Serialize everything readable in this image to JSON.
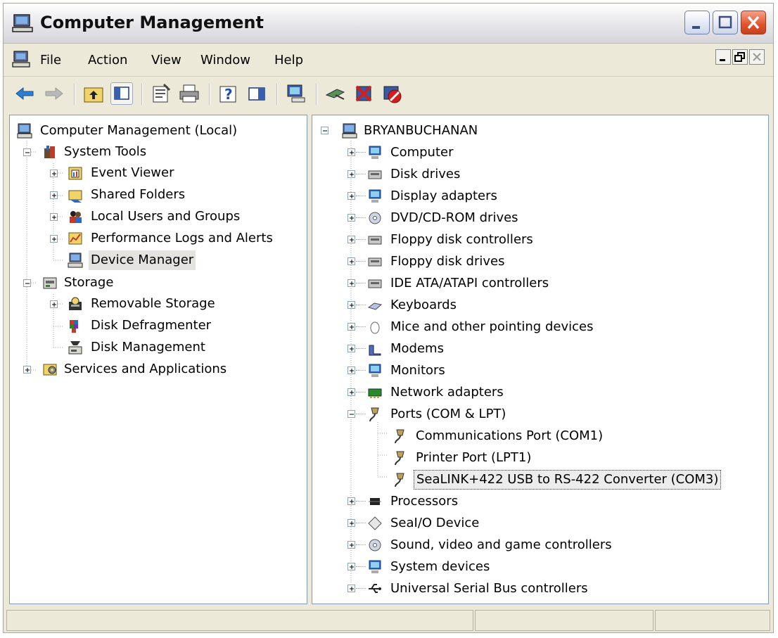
{
  "window": {
    "title": "Computer Management",
    "title_icon": "computer-management-icon"
  },
  "menubar": {
    "items": [
      {
        "label": "File",
        "underline": "F"
      },
      {
        "label": "Action",
        "underline": "A"
      },
      {
        "label": "View",
        "underline": "V"
      },
      {
        "label": "Window",
        "underline": "W"
      },
      {
        "label": "Help",
        "underline": "H"
      }
    ]
  },
  "toolbar": {
    "buttons": [
      "back-icon",
      "forward-icon",
      "up-one-level-icon",
      "show-hide-console-tree-icon",
      "properties-icon",
      "print-icon",
      "help-icon",
      "show-hide-action-pane-icon",
      "scan-hardware-icon",
      "update-driver-icon",
      "uninstall-icon",
      "disable-icon"
    ]
  },
  "left_tree": {
    "root": "Computer Management (Local)",
    "system_tools": "System Tools",
    "event_viewer": "Event Viewer",
    "shared_folders": "Shared Folders",
    "local_users": "Local Users and Groups",
    "perf_logs": "Performance Logs and Alerts",
    "device_manager": "Device Manager",
    "storage": "Storage",
    "removable_storage": "Removable Storage",
    "disk_defrag": "Disk Defragmenter",
    "disk_mgmt": "Disk Management",
    "services": "Services and Applications"
  },
  "right_tree": {
    "root": "BRYANBUCHANAN",
    "items": [
      "Computer",
      "Disk drives",
      "Display adapters",
      "DVD/CD-ROM drives",
      "Floppy disk controllers",
      "Floppy disk drives",
      "IDE ATA/ATAPI controllers",
      "Keyboards",
      "Mice and other pointing devices",
      "Modems",
      "Monitors",
      "Network adapters",
      "Ports (COM & LPT)"
    ],
    "ports_children": [
      "Communications Port (COM1)",
      "Printer Port (LPT1)",
      "SeaLINK+422 USB to RS-422 Converter (COM3)"
    ],
    "items_after": [
      "Processors",
      "SeaI/O Device",
      "Sound, video and game controllers",
      "System devices",
      "Universal Serial Bus controllers"
    ]
  },
  "colors": {
    "accent": "#316ac5",
    "window_bg": "#ece9d8",
    "close_button": "#e0532c"
  }
}
